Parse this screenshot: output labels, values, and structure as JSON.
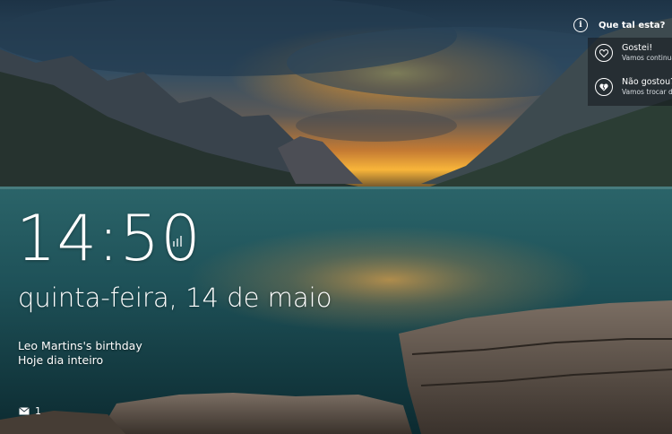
{
  "lockscreen": {
    "time": "14:50",
    "date": "quinta-feira, 14 de maio",
    "event": {
      "title": "Leo Martins's birthday",
      "when": "Hoje dia inteiro"
    },
    "mail": {
      "icon": "mail-icon",
      "count": "1"
    }
  },
  "spotlight": {
    "title": "Que tal esta?",
    "info_icon": "info-icon",
    "like": {
      "label": "Gostei!",
      "sub": "Vamos continuar",
      "icon": "heart-icon"
    },
    "dislike": {
      "label": "Não gostou?",
      "sub": "Vamos trocar de",
      "icon": "broken-heart-icon"
    }
  },
  "colors": {
    "text": "#ffffff",
    "sky": "#2c4a63",
    "sunset": "#f7a530",
    "lake": "#1c5560"
  }
}
